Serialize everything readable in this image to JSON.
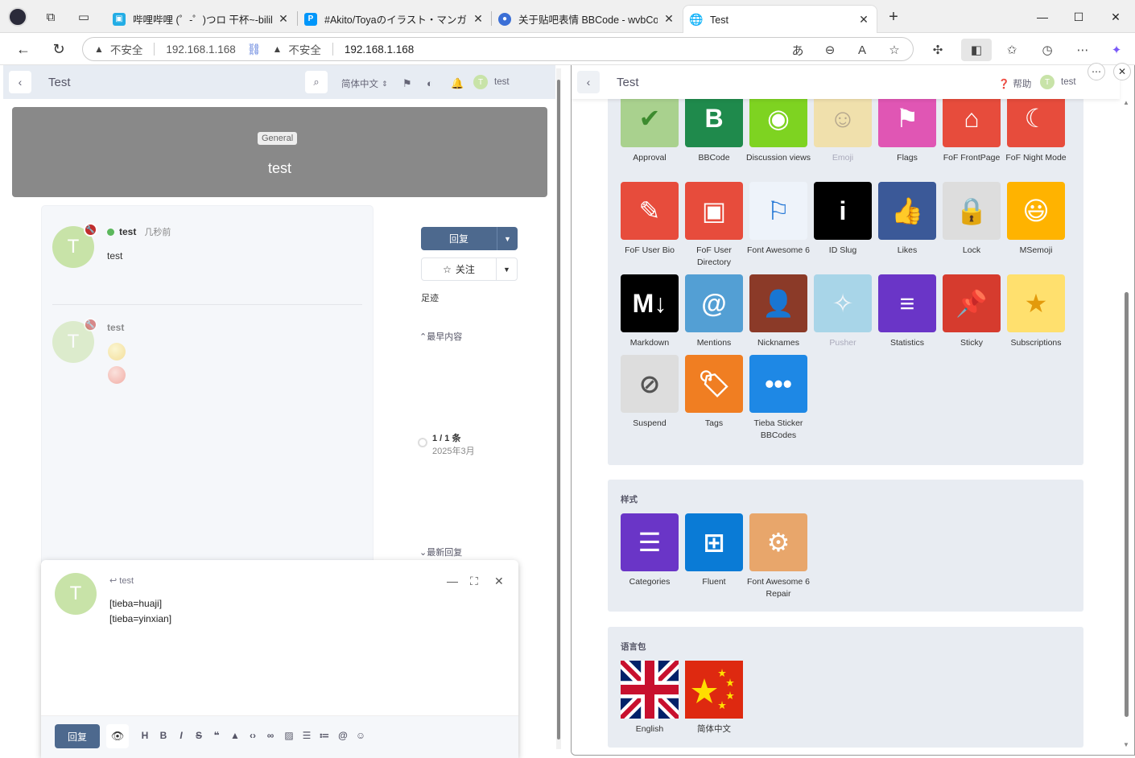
{
  "browser": {
    "tabs": [
      {
        "title": "哔哩哔哩 (゜-゜)つロ 干杯~-bilibi",
        "favicon_color": "#23ade5",
        "favicon_glyph": "tv-icon"
      },
      {
        "title": "#Akito/Toyaのイラスト・マンガ(",
        "favicon_color": "#0096fa",
        "favicon_glyph": "P"
      },
      {
        "title": "关于贴吧表情 BBCode - wvbCom",
        "favicon_color": "#3b6fd6",
        "favicon_glyph": "globe-icon"
      },
      {
        "title": "Test",
        "favicon_color": "#ffffff",
        "favicon_glyph": "globe-icon"
      }
    ],
    "address": {
      "left_warning": "不安全",
      "left_url": "192.168.1.168",
      "right_warning": "不安全",
      "right_url": "192.168.1.168"
    }
  },
  "left": {
    "header": {
      "title": "Test",
      "language": "简体中文",
      "user": "test",
      "avatar_letter": "T"
    },
    "hero": {
      "tag": "General",
      "title": "test"
    },
    "posts": [
      {
        "user": "test",
        "time": "几秒前",
        "body": "test",
        "avatar_letter": "T"
      },
      {
        "user": "test",
        "avatar_letter": "T"
      }
    ],
    "sidebar": {
      "reply": "回复",
      "follow": "关注",
      "footprint": "足迹",
      "earliest": "最早内容",
      "count": "1 / 1 条",
      "date": "2025年3月",
      "latest": "最新回复"
    },
    "composer": {
      "reply_to": "test",
      "avatar_letter": "T",
      "lines": [
        "[tieba=huaji]",
        "[tieba=yinxian]"
      ],
      "submit": "回复"
    }
  },
  "right": {
    "header": {
      "title": "Test",
      "help": "帮助",
      "user": "test",
      "avatar_letter": "T"
    },
    "features": [
      {
        "label": "Approval",
        "color": "#a9d18e",
        "icon": "check-icon",
        "glyph": "✔",
        "fg": "#3d8b2f"
      },
      {
        "label": "BBCode",
        "color": "#1f8a4c",
        "icon": "bbcode-icon",
        "glyph": "B",
        "fg": "#ffffff"
      },
      {
        "label": "Discussion views",
        "color": "#7ed321",
        "icon": "eye-icon",
        "glyph": "◉",
        "fg": "#ffffff"
      },
      {
        "label": "Emoji",
        "color": "#f7d774",
        "icon": "smile-icon",
        "glyph": "☺",
        "fg": "#8a6d3b",
        "disabled": true
      },
      {
        "label": "Flags",
        "color": "#e056b4",
        "icon": "flag-icon",
        "glyph": "⚑",
        "fg": "#ffffff"
      },
      {
        "label": "FoF FrontPage",
        "color": "#e74c3c",
        "icon": "home-icon",
        "glyph": "⌂",
        "fg": "#ffffff"
      },
      {
        "label": "FoF Night Mode",
        "color": "#e74c3c",
        "icon": "moon-icon",
        "glyph": "☾",
        "fg": "#ffffff"
      },
      {
        "label": "FoF User Bio",
        "color": "#e74c3c",
        "icon": "pencil-icon",
        "glyph": "✎",
        "fg": "#ffffff"
      },
      {
        "label": "FoF User Directory",
        "color": "#e74c3c",
        "icon": "address-book-icon",
        "glyph": "▣",
        "fg": "#ffffff"
      },
      {
        "label": "Font Awesome 6",
        "color": "#eef3fa",
        "icon": "font-awesome-flag-icon",
        "glyph": "⚐",
        "fg": "#1c72d4"
      },
      {
        "label": "ID Slug",
        "color": "#000000",
        "icon": "info-icon",
        "glyph": "i",
        "fg": "#ffffff"
      },
      {
        "label": "Likes",
        "color": "#3b5998",
        "icon": "thumbs-up-icon",
        "glyph": "👍",
        "fg": "#ffffff"
      },
      {
        "label": "Lock",
        "color": "#dddddd",
        "icon": "lock-icon",
        "glyph": "🔒",
        "fg": "#555555"
      },
      {
        "label": "MSemoji",
        "color": "#ffb300",
        "icon": "msemoji-icon",
        "glyph": "😃",
        "fg": "#ffffff"
      },
      {
        "label": "Markdown",
        "color": "#000000",
        "icon": "markdown-icon",
        "glyph": "M↓",
        "fg": "#ffffff"
      },
      {
        "label": "Mentions",
        "color": "#539fd4",
        "icon": "at-icon",
        "glyph": "@",
        "fg": "#ffffff"
      },
      {
        "label": "Nicknames",
        "color": "#8b3a28",
        "icon": "user-tag-icon",
        "glyph": "👤",
        "fg": "#ffffff"
      },
      {
        "label": "Pusher",
        "color": "#74c3e0",
        "icon": "pusher-icon",
        "glyph": "✧",
        "fg": "#ffffff",
        "disabled": true
      },
      {
        "label": "Statistics",
        "color": "#6a35c7",
        "icon": "chart-icon",
        "glyph": "≡",
        "fg": "#ffffff"
      },
      {
        "label": "Sticky",
        "color": "#d63b2e",
        "icon": "thumbtack-icon",
        "glyph": "📌",
        "fg": "#ffffff"
      },
      {
        "label": "Subscriptions",
        "color": "#ffe06e",
        "icon": "star-icon",
        "glyph": "★",
        "fg": "#e39a0c"
      },
      {
        "label": "Suspend",
        "color": "#dddddd",
        "icon": "ban-icon",
        "glyph": "⊘",
        "fg": "#555555"
      },
      {
        "label": "Tags",
        "color": "#f07e22",
        "icon": "tags-icon",
        "glyph": "🏷",
        "fg": "#ffffff"
      },
      {
        "label": "Tieba Sticker BBCodes",
        "color": "#1e88e5",
        "icon": "sticker-icon",
        "glyph": "•••",
        "fg": "#ffffff"
      }
    ],
    "themes": {
      "title": "样式",
      "items": [
        {
          "label": "Categories",
          "color": "#6a35c7",
          "icon": "list-icon",
          "glyph": "☰",
          "fg": "#ffffff"
        },
        {
          "label": "Fluent",
          "color": "#0a7bd6",
          "icon": "windows-icon",
          "glyph": "⊞",
          "fg": "#ffffff"
        },
        {
          "label": "Font Awesome 6 Repair",
          "color": "#e8a66b",
          "icon": "gear-icon",
          "glyph": "⚙",
          "fg": "#ffffff"
        }
      ]
    },
    "languages": {
      "title": "语言包",
      "items": [
        {
          "label": "English",
          "color": "#012169",
          "icon": "uk-flag-icon"
        },
        {
          "label": "简体中文",
          "color": "#de2910",
          "icon": "china-flag-icon"
        }
      ]
    }
  }
}
